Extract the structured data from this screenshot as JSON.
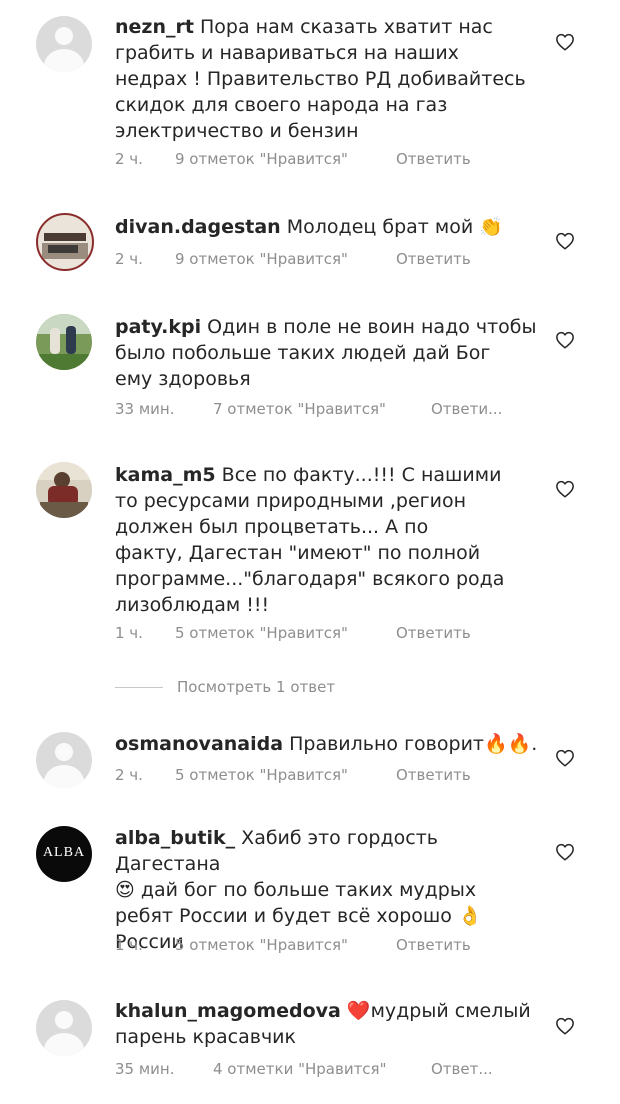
{
  "comments": [
    {
      "username": "nezn_rt",
      "text": "Пора нам сказать хватит нас\nграбить и навариваться на наших\nнедрах ! Правительство РД добивайтесь\nскидок для своего народа на газ\nэлектричество и бензин",
      "time": "2 ч.",
      "likes": "9 отметок \"Нравится\"",
      "reply": "Ответить",
      "avatar": "default-avatar"
    },
    {
      "username": "divan.dagestan",
      "text": "Молодец брат мой 👏",
      "time": "2 ч.",
      "likes": "9 отметок \"Нравится\"",
      "reply": "Ответить",
      "avatar": "photo-avatar"
    },
    {
      "username": "paty.kpi",
      "text": "Один в поле не воин надо чтобы\nбыло побольше таких людей дай Бог\nему здоровья",
      "time": "33 мин.",
      "likes": "7 отметок \"Нравится\"",
      "reply": "Ответи...",
      "avatar": "photo-avatar"
    },
    {
      "username": "kama_m5",
      "text": "Все по факту...!!! С нашими\nто ресурсами природными ,регион\nдолжен был процветать... А по\nфакту, Дагестан \"имеют\" по полной\nпрограмме...\"благодаря\" всякого рода\nлизоблюдам !!!",
      "time": "1 ч.",
      "likes": "5 отметок \"Нравится\"",
      "reply": "Ответить",
      "avatar": "photo-avatar"
    },
    {
      "username": "osmanovanaida",
      "text": "Правильно говорит🔥🔥.",
      "time": "2 ч.",
      "likes": "5 отметок \"Нравится\"",
      "reply": "Ответить",
      "avatar": "default-avatar"
    },
    {
      "username": "alba_butik_",
      "text": "Хабиб это гордость Дагестана\n😍 дай бог по больше таких мудрых\nребят России  и будет всё хорошо 👌\nРоссии",
      "time": "1 ч.",
      "likes": "5 отметок \"Нравится\"",
      "reply": "Ответить",
      "avatar": "alba-logo-avatar",
      "avatar_text": "ALBA"
    },
    {
      "username": "khalun_magomedova",
      "text": "❤️мудрый смелый\nпарень красавчик",
      "time": "35 мин.",
      "likes": "4 отметки \"Нравится\"",
      "reply": "Ответ...",
      "avatar": "default-avatar"
    }
  ],
  "view_replies": "Посмотреть 1 ответ",
  "icons": {
    "like": "heart-outline-icon"
  },
  "colors": {
    "text": "#262626",
    "meta": "#8e8e8e",
    "divider": "#c7c7c7",
    "avatar_default": "#dbdbdb"
  }
}
